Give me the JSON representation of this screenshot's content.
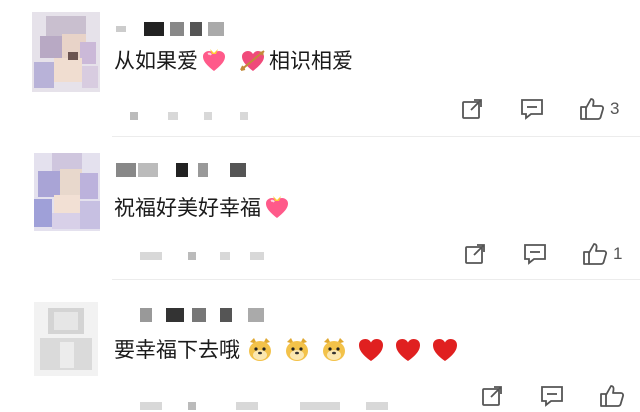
{
  "comments": [
    {
      "text_parts": [
        "从如果爱",
        "相识相爱"
      ],
      "emojis": [
        "heart-with-ribbon",
        "heart-with-arrow"
      ],
      "like_count": "3"
    },
    {
      "text_parts": [
        "祝福好美好幸福"
      ],
      "emojis": [
        "heart-with-ribbon"
      ],
      "like_count": "1"
    },
    {
      "text_parts": [
        "要幸福下去哦"
      ],
      "emojis": [
        "doge",
        "doge",
        "doge",
        "red-heart",
        "red-heart",
        "red-heart"
      ],
      "like_count": ""
    }
  ],
  "icons": {
    "share": "share-icon",
    "reply": "comment-icon",
    "like": "thumbs-up-icon"
  },
  "colors": {
    "icon_stroke": "#555555",
    "heart_red": "#e02020",
    "heart_pink": "#ff5a8a",
    "doge_yellow": "#f3c24a",
    "divider": "#ececec"
  }
}
